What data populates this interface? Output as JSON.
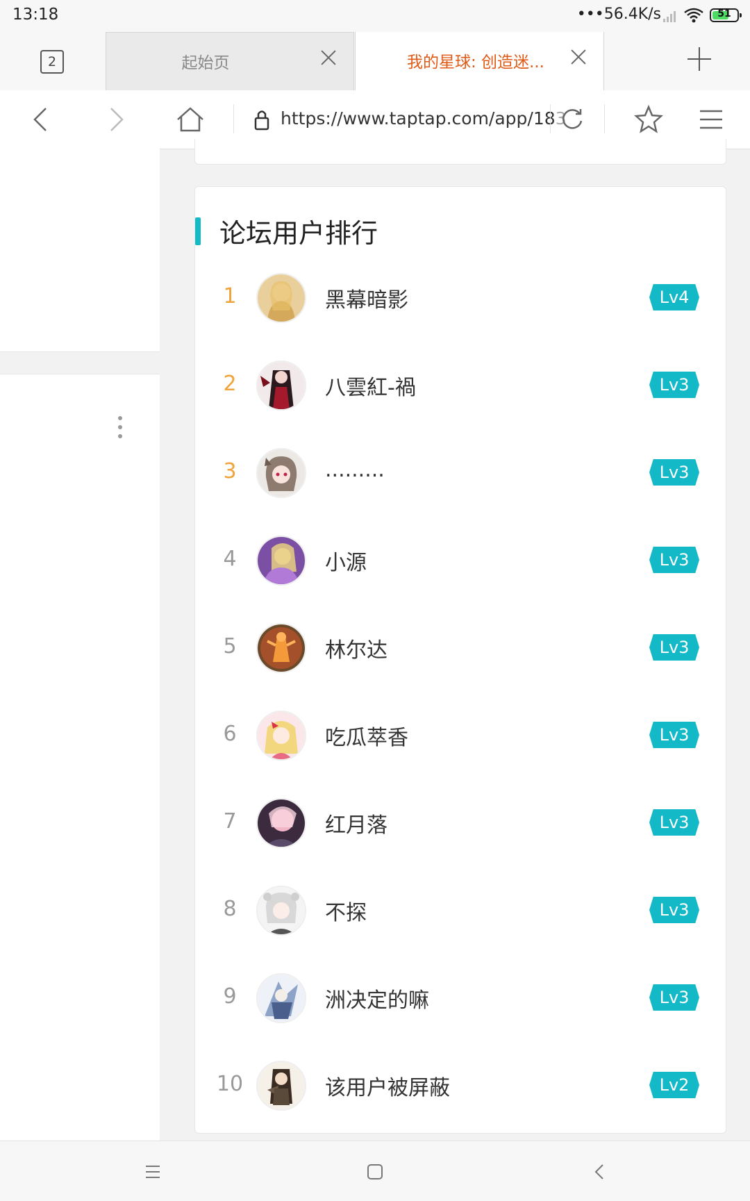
{
  "status_bar": {
    "time": "13:18",
    "net_speed": "•••56.4K/s",
    "battery": "51"
  },
  "tabs": {
    "count": "2",
    "items": [
      {
        "title": "起始页",
        "active": false
      },
      {
        "title": "我的星球: 创造迷...",
        "active": true
      }
    ]
  },
  "toolbar": {
    "url_main": "https://www.taptap.com/app/18",
    "url_faded": "3"
  },
  "ranking": {
    "title": "论坛用户排行",
    "users": [
      {
        "rank": "1",
        "name": "黑幕暗影",
        "level": "Lv4"
      },
      {
        "rank": "2",
        "name": "八雲紅-禍",
        "level": "Lv3"
      },
      {
        "rank": "3",
        "name": ".........",
        "level": "Lv3"
      },
      {
        "rank": "4",
        "name": "小源",
        "level": "Lv3"
      },
      {
        "rank": "5",
        "name": "林尔达",
        "level": "Lv3"
      },
      {
        "rank": "6",
        "name": "吃瓜萃香",
        "level": "Lv3"
      },
      {
        "rank": "7",
        "name": "红月落",
        "level": "Lv3"
      },
      {
        "rank": "8",
        "name": "不探",
        "level": "Lv3"
      },
      {
        "rank": "9",
        "name": "洲决定的嘛",
        "level": "Lv3"
      },
      {
        "rank": "10",
        "name": "该用户被屏蔽",
        "level": "Lv2"
      }
    ]
  },
  "colors": {
    "accent": "#14b9c8",
    "top_rank": "#f0a23b",
    "active_tab": "#e05a16"
  }
}
